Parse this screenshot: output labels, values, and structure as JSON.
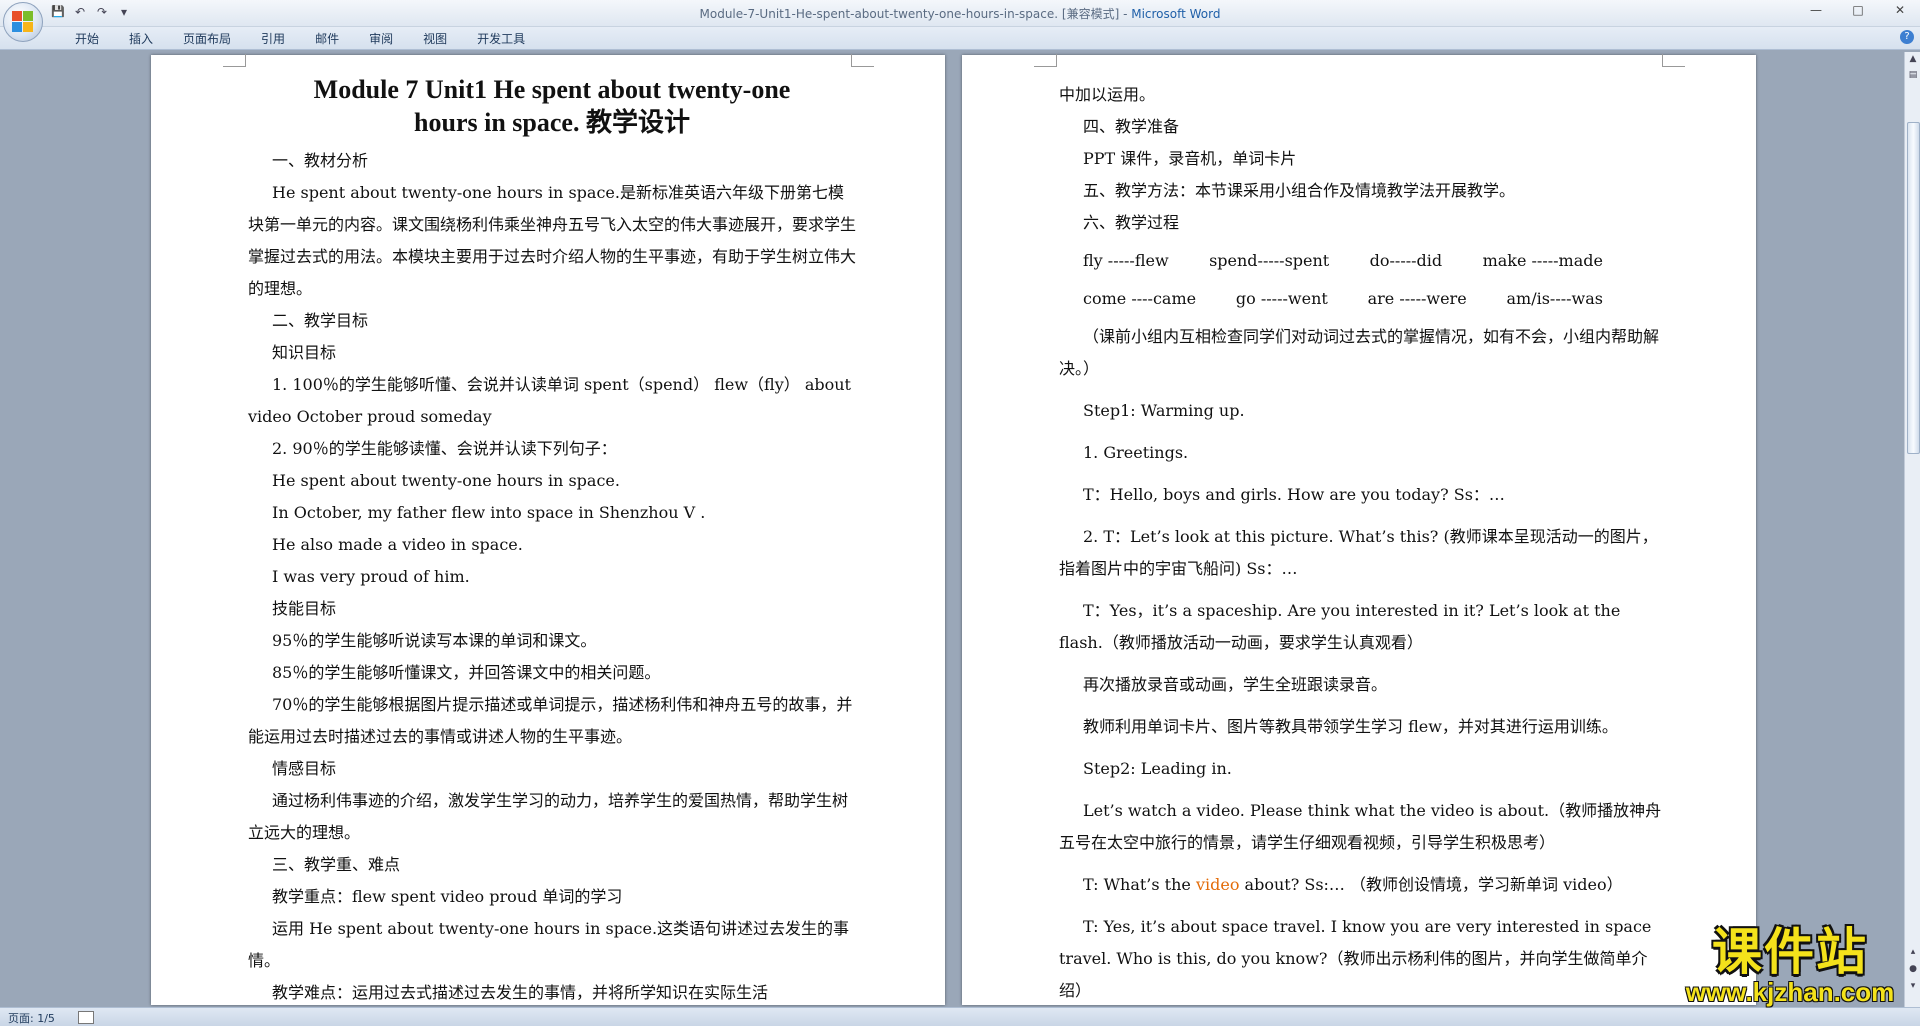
{
  "window": {
    "doc_title": "Module-7-Unit1-He-spent-about-twenty-one-hours-in-space. [兼容模式] - ",
    "app_name": "Microsoft Word"
  },
  "qat": {
    "save": "💾",
    "undo": "↶",
    "redo": "↷",
    "more": "▾"
  },
  "ribbon": {
    "tabs": [
      "开始",
      "插入",
      "页面布局",
      "引用",
      "邮件",
      "审阅",
      "视图",
      "开发工具"
    ]
  },
  "page1": {
    "title_line1": "Module 7 Unit1 He spent about twenty-one",
    "title_line2": "hours in space.  教学设计",
    "paras": [
      "一、教材分析",
      "He spent about twenty-one hours in space.是新标准英语六年级下册第七模块第一单元的内容。课文围绕杨利伟乘坐神舟五号飞入太空的伟大事迹展开，要求学生掌握过去式的用法。本模块主要用于过去时介绍人物的生平事迹，有助于学生树立伟大的理想。",
      "二、教学目标",
      "知识目标",
      "1. 100％的学生能够听懂、会说并认读单词 spent（spend） flew（fly） about  video  October  proud  someday",
      "2. 90％的学生能够读懂、会说并认读下列句子：",
      "He spent about twenty-one hours in space.",
      "In October, my father flew into space in Shenzhou V .",
      "He also made a video in space.",
      "I was very proud of him.",
      "技能目标",
      "95％的学生能够听说读写本课的单词和课文。",
      "85％的学生能够听懂课文，并回答课文中的相关问题。",
      "70％的学生能够根据图片提示描述或单词提示，描述杨利伟和神舟五号的故事，并能运用过去时描述过去的事情或讲述人物的生平事迹。",
      "情感目标",
      "通过杨利伟事迹的介绍，激发学生学习的动力，培养学生的爱国热情，帮助学生树立远大的理想。",
      "三、教学重、难点",
      "教学重点：flew   spent   video   proud 单词的学习",
      "运用 He spent about twenty-one hours in space.这类语句讲述过去发生的事情。",
      "教学难点：运用过去式描述过去发生的事情，并将所学知识在实际生活"
    ]
  },
  "page2": {
    "top": [
      "中加以运用。",
      "四、教学准备",
      "PPT 课件，录音机，单词卡片",
      "五、教学方法：本节课采用小组合作及情境教学法开展教学。",
      "六、教学过程"
    ],
    "verbs_row1": [
      "fly -----flew",
      "spend-----spent",
      "do-----did",
      "make -----made"
    ],
    "verbs_row2": [
      "come ----came",
      "go -----went",
      "are -----were",
      "am/is----was"
    ],
    "rest": [
      "（课前小组内互相检查同学们对动词过去式的掌握情况，如有不会，小组内帮助解决。）",
      "Step1: Warming up.",
      "1. Greetings.",
      "T：Hello, boys and girls. How are you today? Ss：…",
      "2. T：Let’s look at this picture. What’s this? (教师课本呈现活动一的图片，指着图片中的宇宙飞船问) Ss：…",
      "T：Yes，it’s a spaceship. Are you interested in it? Let’s look at the flash.（教师播放活动一动画，要求学生认真观看）",
      "再次播放录音或动画，学生全班跟读录音。",
      "教师利用单词卡片、图片等教具带领学生学习 flew，并对其进行运用训练。",
      "Step2: Leading in.",
      "Let’s watch a video. Please think what the video is about.（教师播放神舟五号在太空中旅行的情景，请学生仔细观看视频，引导学生积极思考）"
    ],
    "video_line": {
      "before": "T: What’s the ",
      "highlight": "video",
      "after": " about? Ss:…  （教师创设情境，学习新单词 video）"
    },
    "last": "T: Yes, it’s about space travel. I know you are very interested in space travel. Who is this, do you know?（教师出示杨利伟的图片，并向学生做简单介绍）"
  },
  "status": {
    "page": "页面: 1/5"
  },
  "watermark": {
    "cn": "课件站",
    "url": "www.kjzhan.com"
  },
  "colors": {
    "highlight": "#e36c09",
    "watermark": "#f4e21b"
  }
}
